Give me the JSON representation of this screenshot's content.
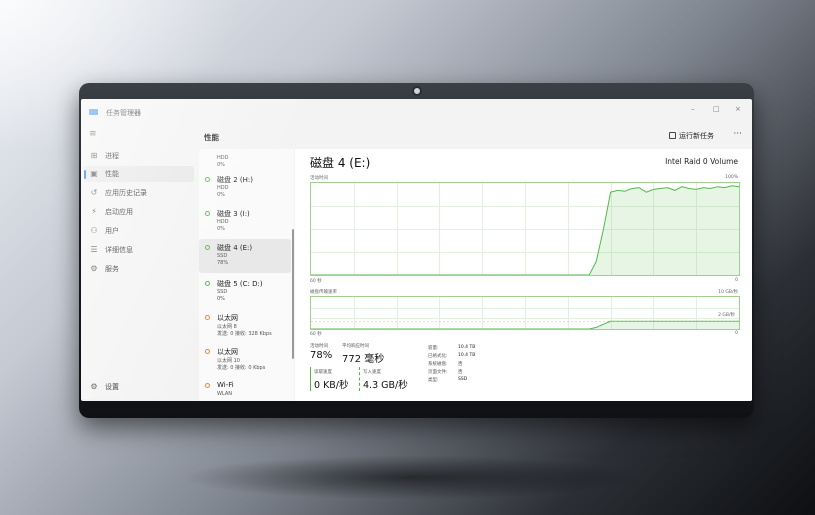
{
  "window": {
    "title": "任务管理器",
    "controls": {
      "minimize": "–",
      "maximize": "□",
      "close": "×"
    }
  },
  "sidebar": {
    "menu_icon": "hamburger-icon",
    "items": [
      {
        "label": "进程",
        "icon": "processes-icon",
        "active": false
      },
      {
        "label": "性能",
        "icon": "performance-icon",
        "active": true
      },
      {
        "label": "应用历史记录",
        "icon": "history-icon",
        "active": false
      },
      {
        "label": "启动应用",
        "icon": "startup-icon",
        "active": false
      },
      {
        "label": "用户",
        "icon": "users-icon",
        "active": false
      },
      {
        "label": "详细信息",
        "icon": "details-icon",
        "active": false
      },
      {
        "label": "服务",
        "icon": "services-icon",
        "active": false
      }
    ],
    "settings": {
      "label": "设置",
      "icon": "gear-icon"
    }
  },
  "header": {
    "title": "性能",
    "run_task_label": "运行新任务",
    "more_label": "···"
  },
  "devices": [
    {
      "name": "",
      "sub1": "HDD",
      "sub2": "0%",
      "status": "green",
      "partial": true
    },
    {
      "name": "磁盘 2 (H:)",
      "sub1": "HDD",
      "sub2": "0%",
      "status": "green"
    },
    {
      "name": "磁盘 3 (I:)",
      "sub1": "HDD",
      "sub2": "0%",
      "status": "green"
    },
    {
      "name": "磁盘 4 (E:)",
      "sub1": "SSD",
      "sub2": "78%",
      "status": "green",
      "selected": true
    },
    {
      "name": "磁盘 5 (C: D:)",
      "sub1": "SSD",
      "sub2": "0%",
      "status": "green"
    },
    {
      "name": "以太网",
      "sub1": "以太网 8",
      "sub2": "发送: 0 接收: 328 Kbps",
      "status": "orange"
    },
    {
      "name": "以太网",
      "sub1": "以太网 10",
      "sub2": "发送: 0 接收: 0 Kbps",
      "status": "orange"
    },
    {
      "name": "Wi-Fi",
      "sub1": "WLAN",
      "sub2": "",
      "status": "orange"
    }
  ],
  "detail": {
    "title": "磁盘 4 (E:)",
    "model": "Intel Raid 0 Volume",
    "chart1": {
      "label": "活动时间",
      "max_label": "100%",
      "time_label": "60 秒",
      "min_label": "0"
    },
    "chart2": {
      "label": "磁盘传输速率",
      "max_label": "10 GB/秒",
      "mid_label": "2 GB/秒",
      "time_label": "60 秒",
      "min_label": "0"
    },
    "stats": {
      "active_time": {
        "label": "活动时间",
        "value": "78%"
      },
      "avg_response": {
        "label": "平均响应时间",
        "value": "772 毫秒"
      },
      "read_speed": {
        "label": "读取速度",
        "value": "0 KB/秒"
      },
      "write_speed": {
        "label": "写入速度",
        "value": "4.3 GB/秒"
      }
    },
    "properties": [
      {
        "k": "容量:",
        "v": "10.4 TB"
      },
      {
        "k": "已格式化:",
        "v": "10.4 TB"
      },
      {
        "k": "系统磁盘:",
        "v": "否"
      },
      {
        "k": "页面文件:",
        "v": "否"
      },
      {
        "k": "类型:",
        "v": "SSD"
      }
    ]
  },
  "chart_data": [
    {
      "type": "area",
      "title": "活动时间",
      "x_range": [
        60,
        0
      ],
      "ylim": [
        0,
        100
      ],
      "y": [
        0,
        0,
        0,
        0,
        0,
        0,
        0,
        0,
        0,
        0,
        0,
        0,
        0,
        0,
        0,
        0,
        0,
        0,
        0,
        0,
        0,
        0,
        0,
        0,
        0,
        0,
        0,
        0,
        0,
        0,
        0,
        0,
        0,
        0,
        0,
        0,
        0,
        0,
        0,
        0,
        15,
        50,
        90,
        92,
        91,
        94,
        95,
        90,
        93,
        94,
        95,
        92,
        96,
        94,
        93,
        95,
        94,
        96,
        95,
        97,
        96
      ],
      "grid": true
    },
    {
      "type": "area",
      "title": "磁盘传输速率",
      "x_range": [
        60,
        0
      ],
      "ylim": [
        0,
        10
      ],
      "y": [
        0,
        0,
        0,
        0,
        0,
        0,
        0,
        0,
        0,
        0,
        0,
        0,
        0,
        0,
        0,
        0,
        0,
        0,
        0,
        0,
        0,
        0,
        0,
        0,
        0,
        0,
        0,
        0,
        0,
        0,
        0,
        0,
        0,
        0,
        0,
        0,
        0,
        0,
        0,
        0,
        0.5,
        1.5,
        2.4,
        2.4,
        2.4,
        2.4,
        2.4,
        2.4,
        2.4,
        2.4,
        2.4,
        2.4,
        2.4,
        2.4,
        2.4,
        2.4,
        2.4,
        2.4,
        2.4,
        2.4,
        2.4
      ],
      "reference_label": "2 GB/秒",
      "grid": true
    }
  ]
}
